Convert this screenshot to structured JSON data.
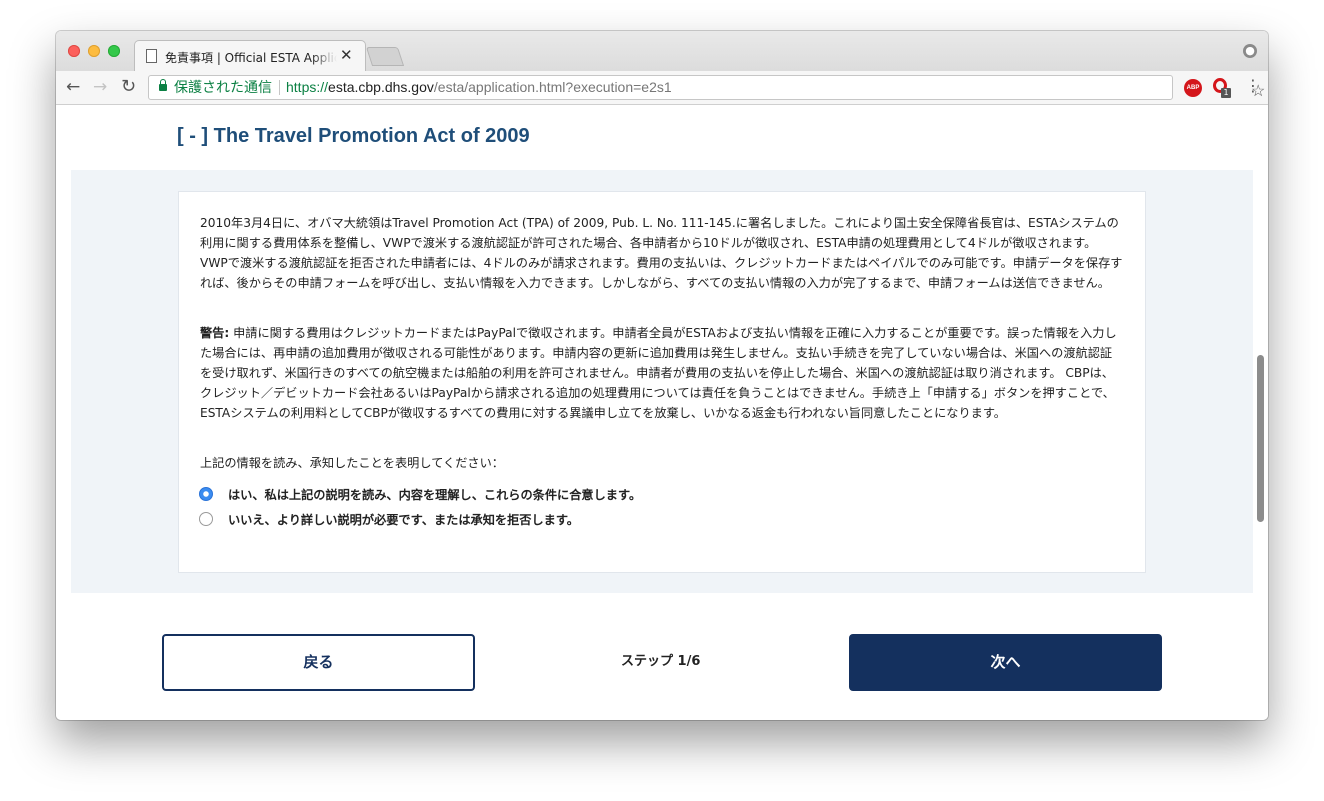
{
  "browser": {
    "tab_title": "免責事項 | Official ESTA Applic",
    "tab_close": "✕",
    "secure_label": "保護された通信",
    "url_scheme": "https://",
    "url_host": "esta.cbp.dhs.gov",
    "url_path": "/esta/application.html?execution=e2s1",
    "abp_label": "ABP",
    "extension_badge": "1"
  },
  "page": {
    "section_title": "[ - ] The Travel Promotion Act of 2009",
    "paragraph1": "2010年3月4日に、オバマ大統領はTravel Promotion Act (TPA) of 2009, Pub. L. No. 111-145.に署名しました。これにより国土安全保障省長官は、ESTAシステムの利用に関する費用体系を整備し、VWPで渡米する渡航認証が許可された場合、各申請者から10ドルが徴収され、ESTA申請の処理費用として4ドルが徴収されます。VWPで渡米する渡航認証を拒否された申請者には、4ドルのみが請求されます。費用の支払いは、クレジットカードまたはペイパルでのみ可能です。申請データを保存すれば、後からその申請フォームを呼び出し、支払い情報を入力できます。しかしながら、すべての支払い情報の入力が完了するまで、申請フォームは送信できません。",
    "warning_label": "警告:",
    "warning_text": " 申請に関する費用はクレジットカードまたはPayPalで徴収されます。申請者全員がESTAおよび支払い情報を正確に入力することが重要です。誤った情報を入力した場合には、再申請の追加費用が徴収される可能性があります。申請内容の更新に追加費用は発生しません。支払い手続きを完了していない場合は、米国への渡航認証を受け取れず、米国行きのすべての航空機または船舶の利用を許可されません。申請者が費用の支払いを停止した場合、米国への渡航認証は取り消されます。 CBPは、クレジット／デビットカード会社あるいはPayPalから請求される追加の処理費用については責任を負うことはできません。手続き上「申請する」ボタンを押すことで、ESTAシステムの利用料としてCBPが徴収するすべての費用に対する異議申し立てを放棄し、いかなる返金も行われない旨同意したことになります。",
    "acknowledge_prompt": "上記の情報を読み、承知したことを表明してください：",
    "options": [
      {
        "label": "はい、私は上記の説明を読み、内容を理解し、これらの条件に合意します。",
        "selected": true
      },
      {
        "label": "いいえ、より詳しい説明が必要です、または承知を拒否します。",
        "selected": false
      }
    ],
    "back_button": "戻る",
    "step_indicator": "ステップ 1/6",
    "next_button": "次へ"
  },
  "colors": {
    "primary": "#14305e",
    "title": "#1f4e79",
    "secure_green": "#0b8043",
    "band_background": "#f0f4f8"
  }
}
